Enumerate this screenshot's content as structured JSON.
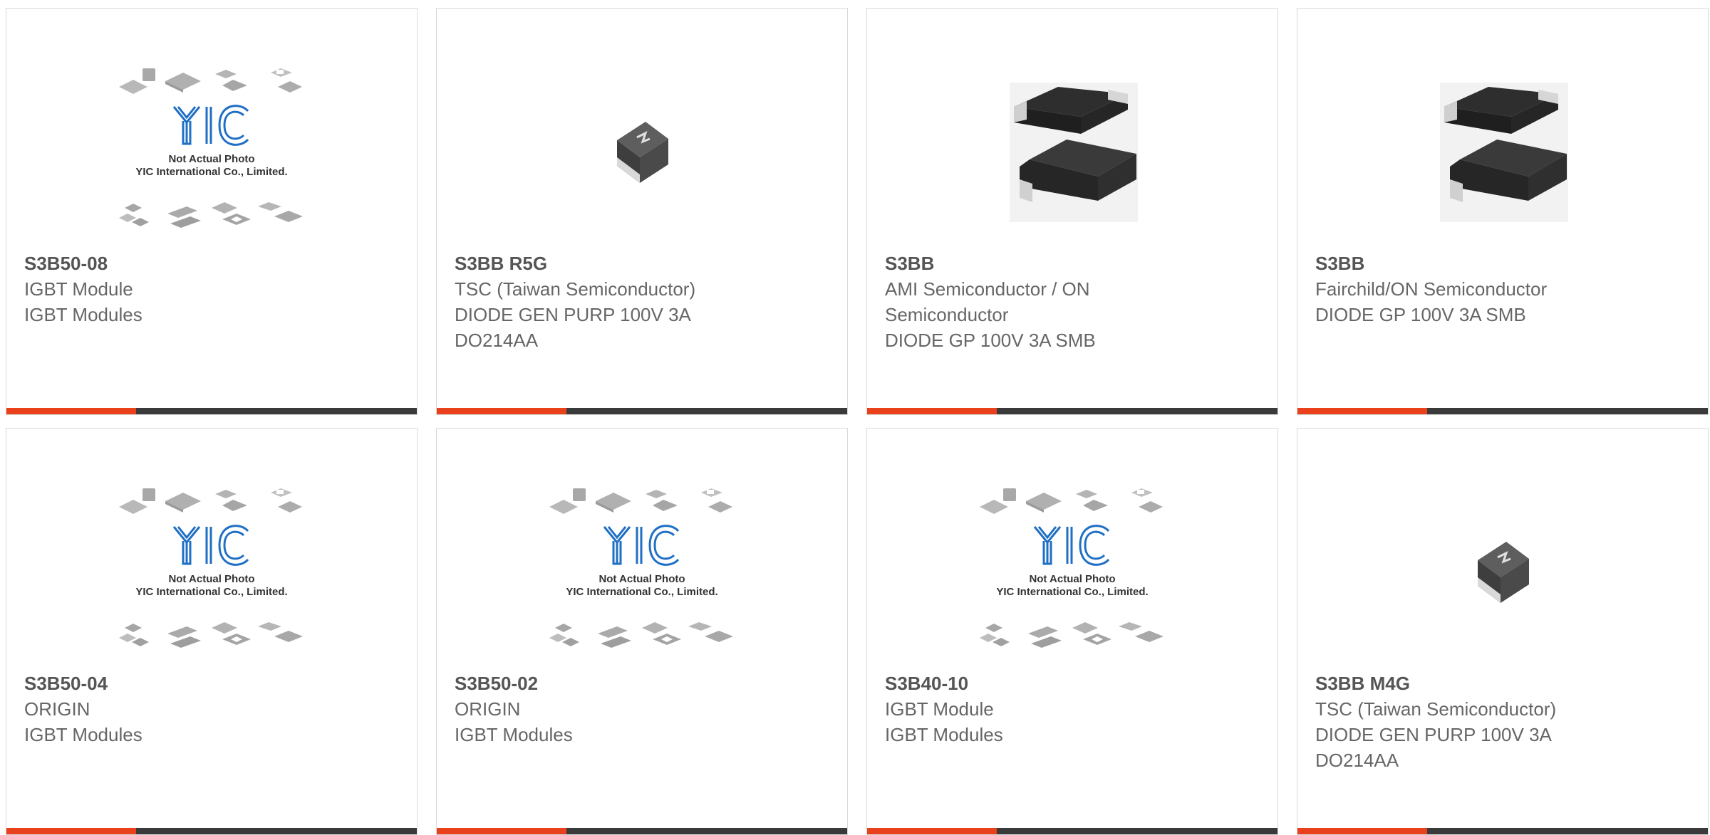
{
  "colors": {
    "accent": "#e8411c",
    "bar": "#3a3a3a",
    "text": "#666666",
    "yic_blue": "#1f6fc4"
  },
  "placeholder": {
    "line1": "Not Actual Photo",
    "line2": "YIC International Co., Limited."
  },
  "products": [
    {
      "part": "S3B50-08",
      "lines": [
        "IGBT Module",
        "IGBT Modules"
      ],
      "image": "yic-placeholder"
    },
    {
      "part": "S3BB R5G",
      "lines": [
        "TSC (Taiwan Semiconductor)",
        "DIODE GEN PURP 100V 3A",
        "DO214AA"
      ],
      "image": "small-diode"
    },
    {
      "part": "S3BB",
      "lines": [
        "AMI Semiconductor / ON",
        "Semiconductor",
        "DIODE GP 100V 3A SMB"
      ],
      "image": "smb-diode"
    },
    {
      "part": "S3BB",
      "lines": [
        "Fairchild/ON Semiconductor",
        "DIODE GP 100V 3A SMB"
      ],
      "image": "smb-diode"
    },
    {
      "part": "S3B50-04",
      "lines": [
        "ORIGIN",
        "IGBT Modules"
      ],
      "image": "yic-placeholder"
    },
    {
      "part": "S3B50-02",
      "lines": [
        "ORIGIN",
        "IGBT Modules"
      ],
      "image": "yic-placeholder"
    },
    {
      "part": "S3B40-10",
      "lines": [
        "IGBT Module",
        "IGBT Modules"
      ],
      "image": "yic-placeholder"
    },
    {
      "part": "S3BB M4G",
      "lines": [
        "TSC (Taiwan Semiconductor)",
        "DIODE GEN PURP 100V 3A",
        "DO214AA"
      ],
      "image": "small-diode"
    }
  ]
}
